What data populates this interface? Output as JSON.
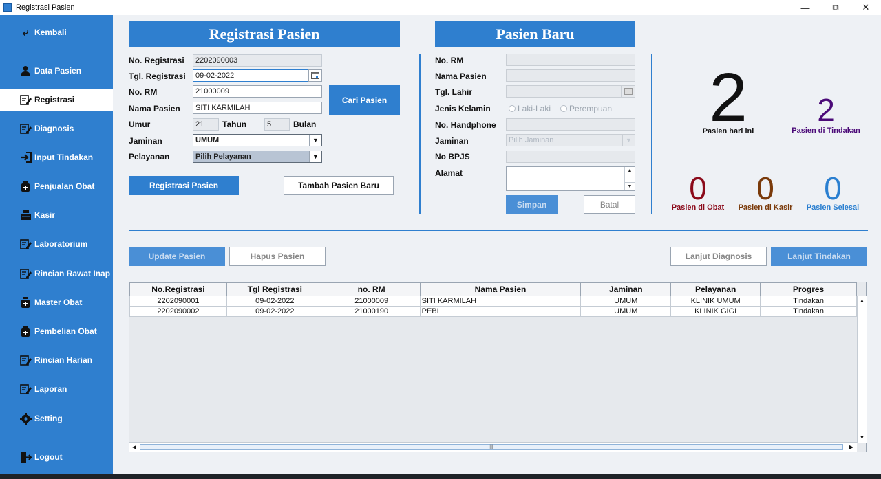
{
  "window": {
    "title": "Registrasi Pasien"
  },
  "sidebar": {
    "items": [
      {
        "label": "Kembali",
        "icon": "back-arrow-icon",
        "active": false
      },
      {
        "label": "Data Pasien",
        "icon": "user-icon",
        "active": false
      },
      {
        "label": "Registrasi",
        "icon": "edit-icon",
        "active": true
      },
      {
        "label": "Diagnosis",
        "icon": "edit-icon",
        "active": false
      },
      {
        "label": "Input Tindakan",
        "icon": "enter-icon",
        "active": false
      },
      {
        "label": "Penjualan Obat",
        "icon": "medicine-icon",
        "active": false
      },
      {
        "label": "Kasir",
        "icon": "cash-register-icon",
        "active": false
      },
      {
        "label": "Laboratorium",
        "icon": "edit-icon",
        "active": false
      },
      {
        "label": "Rincian Rawat Inap",
        "icon": "edit-icon",
        "active": false
      },
      {
        "label": "Master Obat",
        "icon": "medicine-icon",
        "active": false
      },
      {
        "label": "Pembelian Obat",
        "icon": "medicine-icon",
        "active": false
      },
      {
        "label": "Rincian Harian",
        "icon": "edit-icon",
        "active": false
      },
      {
        "label": "Laporan",
        "icon": "edit-icon",
        "active": false
      },
      {
        "label": "Setting",
        "icon": "gear-icon",
        "active": false
      },
      {
        "label": "Logout",
        "icon": "logout-icon",
        "active": false
      }
    ]
  },
  "registrasi": {
    "title": "Registrasi Pasien",
    "no_registrasi_label": "No. Registrasi",
    "no_registrasi": "2202090003",
    "tgl_registrasi_label": "Tgl. Registrasi",
    "tgl_registrasi": "09-02-2022",
    "no_rm_label": "No. RM",
    "no_rm": "21000009",
    "nama_pasien_label": "Nama Pasien",
    "nama_pasien": "SITI KARMILAH",
    "umur_label": "Umur",
    "umur_tahun": "21",
    "tahun_label": "Tahun",
    "umur_bulan": "5",
    "bulan_label": "Bulan",
    "jaminan_label": "Jaminan",
    "jaminan": "UMUM",
    "pelayanan_label": "Pelayanan",
    "pelayanan": "Pilih Pelayanan",
    "cari_pasien_button": "Cari Pasien",
    "registrasi_button": "Registrasi Pasien",
    "tambah_button": "Tambah Pasien Baru"
  },
  "pasien_baru": {
    "title": "Pasien Baru",
    "no_rm_label": "No. RM",
    "nama_pasien_label": "Nama Pasien",
    "tgl_lahir_label": "Tgl. Lahir",
    "jenis_kelamin_label": "Jenis Kelamin",
    "laki_laki": "Laki-Laki",
    "perempuan": "Perempuan",
    "handphone_label": "No. Handphone",
    "jaminan_label": "Jaminan",
    "jaminan_placeholder": "Pilih Jaminan",
    "bpjs_label": "No BPJS",
    "alamat_label": "Alamat",
    "simpan_button": "Simpan",
    "batal_button": "Batal"
  },
  "stats": {
    "hari_ini": {
      "value": "2",
      "label": "Pasien hari ini",
      "color": "#222222"
    },
    "tindakan": {
      "value": "2",
      "label": "Pasien di Tindakan",
      "color": "#4b0a78"
    },
    "obat": {
      "value": "0",
      "label": "Pasien di Obat",
      "color": "#8b0a1a"
    },
    "kasir": {
      "value": "0",
      "label": "Pasien di Kasir",
      "color": "#7a3a0a"
    },
    "selesai": {
      "value": "0",
      "label": "Pasien Selesai",
      "color": "#2a7fd0"
    }
  },
  "actions": {
    "update_pasien": "Update Pasien",
    "hapus_pasien": "Hapus Pasien",
    "lanjut_diagnosis": "Lanjut Diagnosis",
    "lanjut_tindakan": "Lanjut Tindakan"
  },
  "table": {
    "columns": [
      "No.Registrasi",
      "Tgl Registrasi",
      "no. RM",
      "Nama Pasien",
      "Jaminan",
      "Pelayanan",
      "Progres"
    ],
    "rows": [
      [
        "2202090001",
        "09-02-2022",
        "21000009",
        "SITI KARMILAH",
        "UMUM",
        "KLINIK UMUM",
        "Tindakan"
      ],
      [
        "2202090002",
        "09-02-2022",
        "21000190",
        "PEBI",
        "UMUM",
        "KLINIK GIGI",
        "Tindakan"
      ]
    ]
  }
}
